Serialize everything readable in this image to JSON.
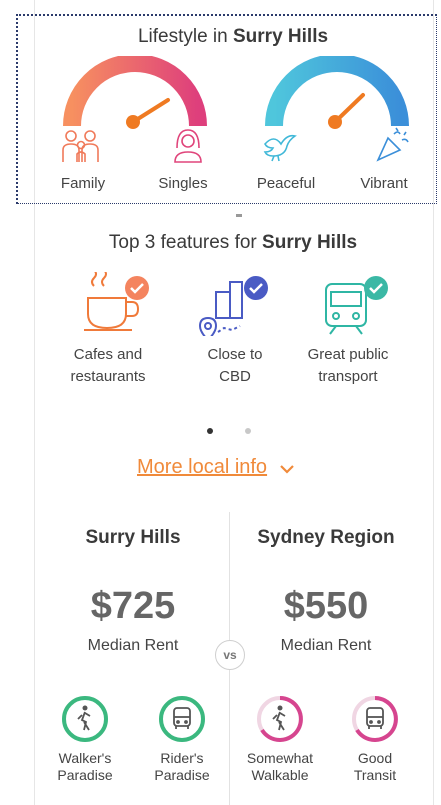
{
  "lifestyle": {
    "title_prefix": "Lifestyle in",
    "suburb": "Surry Hills",
    "gauges": [
      {
        "left_label": "Family",
        "right_label": "Singles",
        "left_icon": "family-icon",
        "right_icon": "single-person-icon",
        "gradient": [
          "#f4845f",
          "#e0457b"
        ]
      },
      {
        "left_label": "Peaceful",
        "right_label": "Vibrant",
        "left_icon": "dove-icon",
        "right_icon": "party-popper-icon",
        "gradient": [
          "#4cc3d9",
          "#3a8fd8"
        ]
      }
    ]
  },
  "features": {
    "title_prefix": "Top 3 features for",
    "suburb": "Surry Hills",
    "items": [
      {
        "line1": "Cafes and",
        "line2": "restaurants",
        "icon": "coffee-cup-icon",
        "badge_color": "#f4845f"
      },
      {
        "line1": "Close to",
        "line2": "CBD",
        "icon": "city-map-icon",
        "badge_color": "#4a5bc4"
      },
      {
        "line1": "Great public",
        "line2": "transport",
        "icon": "train-icon",
        "badge_color": "#3bb8a5"
      }
    ],
    "pagination": {
      "total": 2,
      "active": 0
    }
  },
  "more_info": {
    "label": "More local info"
  },
  "comparison": {
    "vs_label": "vs",
    "left": {
      "name": "Surry Hills",
      "price": "$725",
      "price_label": "Median Rent",
      "scores": [
        {
          "line1": "Walker's",
          "line2": "Paradise",
          "icon": "walker-icon",
          "level": 1.0
        },
        {
          "line1": "Rider's",
          "line2": "Paradise",
          "icon": "bus-icon",
          "level": 1.0
        }
      ]
    },
    "right": {
      "name": "Sydney Region",
      "price": "$550",
      "price_label": "Median Rent",
      "scores": [
        {
          "line1": "Somewhat",
          "line2": "Walkable",
          "icon": "walker-icon",
          "level": 0.6
        },
        {
          "line1": "Good",
          "line2": "Transit",
          "icon": "bus-icon",
          "level": 0.6
        }
      ]
    },
    "colors": {
      "full": "#3bb87f",
      "partial": "#d6458f"
    }
  }
}
